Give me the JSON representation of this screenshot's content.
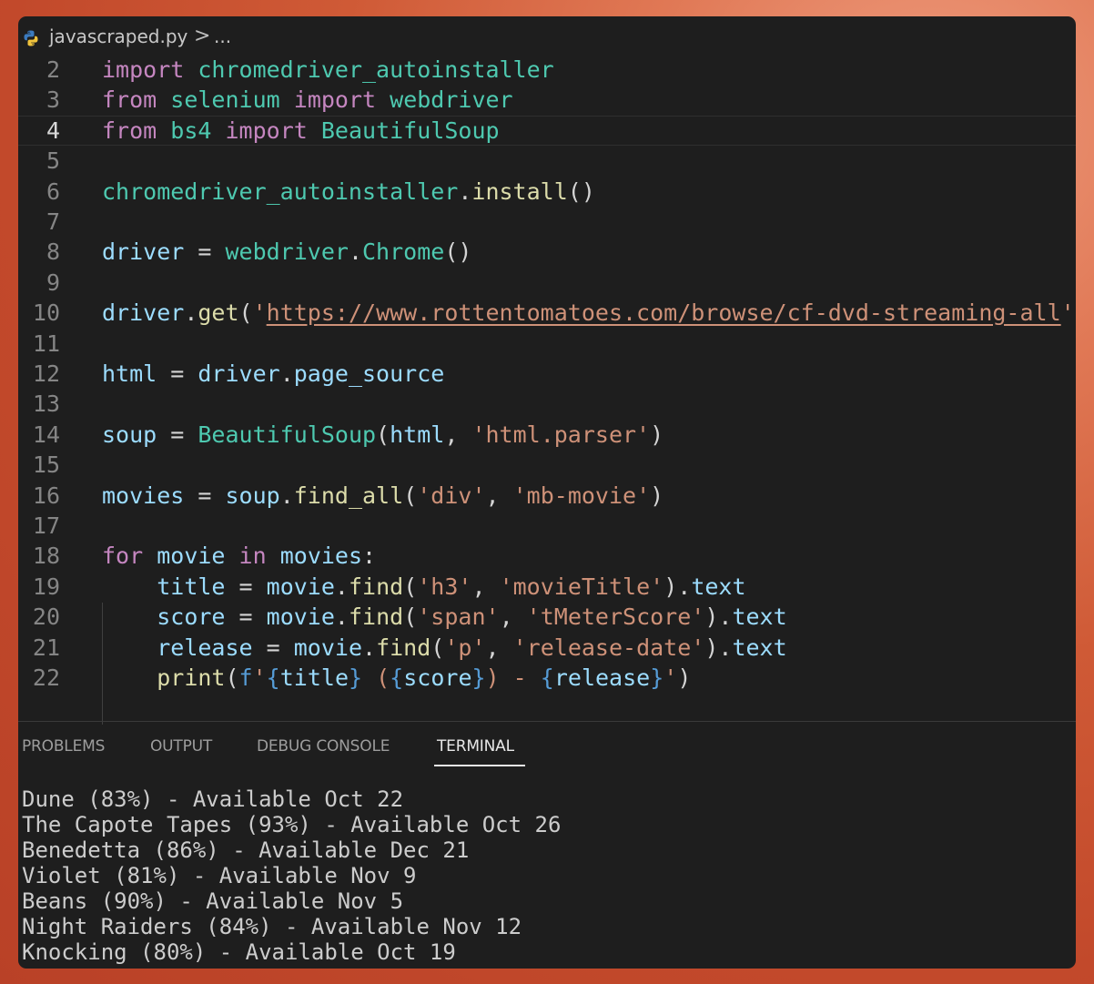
{
  "editor": {
    "breadcrumb": {
      "file": "javascraped.py",
      "separator": ">",
      "more": "..."
    },
    "current_line": "4",
    "lines": [
      {
        "n": "2",
        "t": [
          {
            "c": "kw",
            "s": "import"
          },
          {
            "c": "",
            "s": " "
          },
          {
            "c": "md",
            "s": "chromedriver_autoinstaller"
          }
        ]
      },
      {
        "n": "3",
        "t": [
          {
            "c": "kw",
            "s": "from"
          },
          {
            "c": "",
            "s": " "
          },
          {
            "c": "md",
            "s": "selenium"
          },
          {
            "c": "",
            "s": " "
          },
          {
            "c": "kw",
            "s": "import"
          },
          {
            "c": "",
            "s": " "
          },
          {
            "c": "md",
            "s": "webdriver"
          }
        ]
      },
      {
        "n": "4",
        "t": [
          {
            "c": "kw",
            "s": "from"
          },
          {
            "c": "",
            "s": " "
          },
          {
            "c": "md",
            "s": "bs4"
          },
          {
            "c": "",
            "s": " "
          },
          {
            "c": "kw",
            "s": "import"
          },
          {
            "c": "",
            "s": " "
          },
          {
            "c": "md",
            "s": "BeautifulSoup"
          }
        ]
      },
      {
        "n": "5",
        "t": []
      },
      {
        "n": "6",
        "t": [
          {
            "c": "md",
            "s": "chromedriver_autoinstaller"
          },
          {
            "c": "",
            "s": "."
          },
          {
            "c": "fn",
            "s": "install"
          },
          {
            "c": "",
            "s": "()"
          }
        ]
      },
      {
        "n": "7",
        "t": []
      },
      {
        "n": "8",
        "t": [
          {
            "c": "vr",
            "s": "driver"
          },
          {
            "c": "",
            "s": " = "
          },
          {
            "c": "md",
            "s": "webdriver"
          },
          {
            "c": "",
            "s": "."
          },
          {
            "c": "md",
            "s": "Chrome"
          },
          {
            "c": "",
            "s": "()"
          }
        ]
      },
      {
        "n": "9",
        "t": []
      },
      {
        "n": "10",
        "t": [
          {
            "c": "vr",
            "s": "driver"
          },
          {
            "c": "",
            "s": "."
          },
          {
            "c": "fn",
            "s": "get"
          },
          {
            "c": "",
            "s": "("
          },
          {
            "c": "st",
            "s": "'"
          },
          {
            "c": "st ul",
            "s": "https://www.rottentomatoes.com/browse/cf-dvd-streaming-all"
          },
          {
            "c": "st",
            "s": "'"
          },
          {
            "c": "",
            "s": ")"
          }
        ]
      },
      {
        "n": "11",
        "t": []
      },
      {
        "n": "12",
        "t": [
          {
            "c": "vr",
            "s": "html"
          },
          {
            "c": "",
            "s": " = "
          },
          {
            "c": "vr",
            "s": "driver"
          },
          {
            "c": "",
            "s": "."
          },
          {
            "c": "vr",
            "s": "page_source"
          }
        ]
      },
      {
        "n": "13",
        "t": []
      },
      {
        "n": "14",
        "t": [
          {
            "c": "vr",
            "s": "soup"
          },
          {
            "c": "",
            "s": " = "
          },
          {
            "c": "md",
            "s": "BeautifulSoup"
          },
          {
            "c": "",
            "s": "("
          },
          {
            "c": "vr",
            "s": "html"
          },
          {
            "c": "",
            "s": ", "
          },
          {
            "c": "st",
            "s": "'html.parser'"
          },
          {
            "c": "",
            "s": ")"
          }
        ]
      },
      {
        "n": "15",
        "t": []
      },
      {
        "n": "16",
        "t": [
          {
            "c": "vr",
            "s": "movies"
          },
          {
            "c": "",
            "s": " = "
          },
          {
            "c": "vr",
            "s": "soup"
          },
          {
            "c": "",
            "s": "."
          },
          {
            "c": "fn",
            "s": "find_all"
          },
          {
            "c": "",
            "s": "("
          },
          {
            "c": "st",
            "s": "'div'"
          },
          {
            "c": "",
            "s": ", "
          },
          {
            "c": "st",
            "s": "'mb-movie'"
          },
          {
            "c": "",
            "s": ")"
          }
        ]
      },
      {
        "n": "17",
        "t": []
      },
      {
        "n": "18",
        "t": [
          {
            "c": "kw",
            "s": "for"
          },
          {
            "c": "",
            "s": " "
          },
          {
            "c": "vr",
            "s": "movie"
          },
          {
            "c": "",
            "s": " "
          },
          {
            "c": "kw",
            "s": "in"
          },
          {
            "c": "",
            "s": " "
          },
          {
            "c": "vr",
            "s": "movies"
          },
          {
            "c": "",
            "s": ":"
          }
        ]
      },
      {
        "n": "19",
        "t": [
          {
            "c": "",
            "s": "    "
          },
          {
            "c": "vr",
            "s": "title"
          },
          {
            "c": "",
            "s": " = "
          },
          {
            "c": "vr",
            "s": "movie"
          },
          {
            "c": "",
            "s": "."
          },
          {
            "c": "fn",
            "s": "find"
          },
          {
            "c": "",
            "s": "("
          },
          {
            "c": "st",
            "s": "'h3'"
          },
          {
            "c": "",
            "s": ", "
          },
          {
            "c": "st",
            "s": "'movieTitle'"
          },
          {
            "c": "",
            "s": ")."
          },
          {
            "c": "vr",
            "s": "text"
          }
        ]
      },
      {
        "n": "20",
        "t": [
          {
            "c": "",
            "s": "    "
          },
          {
            "c": "vr",
            "s": "score"
          },
          {
            "c": "",
            "s": " = "
          },
          {
            "c": "vr",
            "s": "movie"
          },
          {
            "c": "",
            "s": "."
          },
          {
            "c": "fn",
            "s": "find"
          },
          {
            "c": "",
            "s": "("
          },
          {
            "c": "st",
            "s": "'span'"
          },
          {
            "c": "",
            "s": ", "
          },
          {
            "c": "st",
            "s": "'tMeterScore'"
          },
          {
            "c": "",
            "s": ")."
          },
          {
            "c": "vr",
            "s": "text"
          }
        ]
      },
      {
        "n": "21",
        "t": [
          {
            "c": "",
            "s": "    "
          },
          {
            "c": "vr",
            "s": "release"
          },
          {
            "c": "",
            "s": " = "
          },
          {
            "c": "vr",
            "s": "movie"
          },
          {
            "c": "",
            "s": "."
          },
          {
            "c": "fn",
            "s": "find"
          },
          {
            "c": "",
            "s": "("
          },
          {
            "c": "st",
            "s": "'p'"
          },
          {
            "c": "",
            "s": ", "
          },
          {
            "c": "st",
            "s": "'release-date'"
          },
          {
            "c": "",
            "s": ")."
          },
          {
            "c": "vr",
            "s": "text"
          }
        ]
      },
      {
        "n": "22",
        "t": [
          {
            "c": "",
            "s": "    "
          },
          {
            "c": "fn",
            "s": "print"
          },
          {
            "c": "",
            "s": "("
          },
          {
            "c": "bl",
            "s": "f"
          },
          {
            "c": "st",
            "s": "'"
          },
          {
            "c": "bl",
            "s": "{"
          },
          {
            "c": "vr",
            "s": "title"
          },
          {
            "c": "bl",
            "s": "}"
          },
          {
            "c": "st",
            "s": " ("
          },
          {
            "c": "bl",
            "s": "{"
          },
          {
            "c": "vr",
            "s": "score"
          },
          {
            "c": "bl",
            "s": "}"
          },
          {
            "c": "st",
            "s": ") - "
          },
          {
            "c": "bl",
            "s": "{"
          },
          {
            "c": "vr",
            "s": "release"
          },
          {
            "c": "bl",
            "s": "}"
          },
          {
            "c": "st",
            "s": "'"
          },
          {
            "c": "",
            "s": ")"
          }
        ]
      }
    ]
  },
  "panel": {
    "tabs": [
      "PROBLEMS",
      "OUTPUT",
      "DEBUG CONSOLE",
      "TERMINAL"
    ],
    "active_tab": "TERMINAL",
    "terminal_lines": [
      "Dune (83%) - Available Oct 22",
      "The Capote Tapes (93%) - Available Oct 26",
      "Benedetta (86%) - Available Dec 21",
      "Violet (81%) - Available Nov 9",
      "Beans (90%) - Available Nov 5",
      "Night Raiders (84%) - Available Nov 12",
      "Knocking (80%) - Available Oct 19"
    ]
  },
  "colors": {
    "editor_bg": "#1e1e1e",
    "keyword": "#c586c0",
    "module": "#4ec9b0",
    "variable": "#9cdcfe",
    "function": "#dcdcaa",
    "string": "#ce9178",
    "fstring_brace": "#569cd6",
    "python_icon_blue": "#3b7bbf",
    "python_icon_yellow": "#f0c33c"
  }
}
